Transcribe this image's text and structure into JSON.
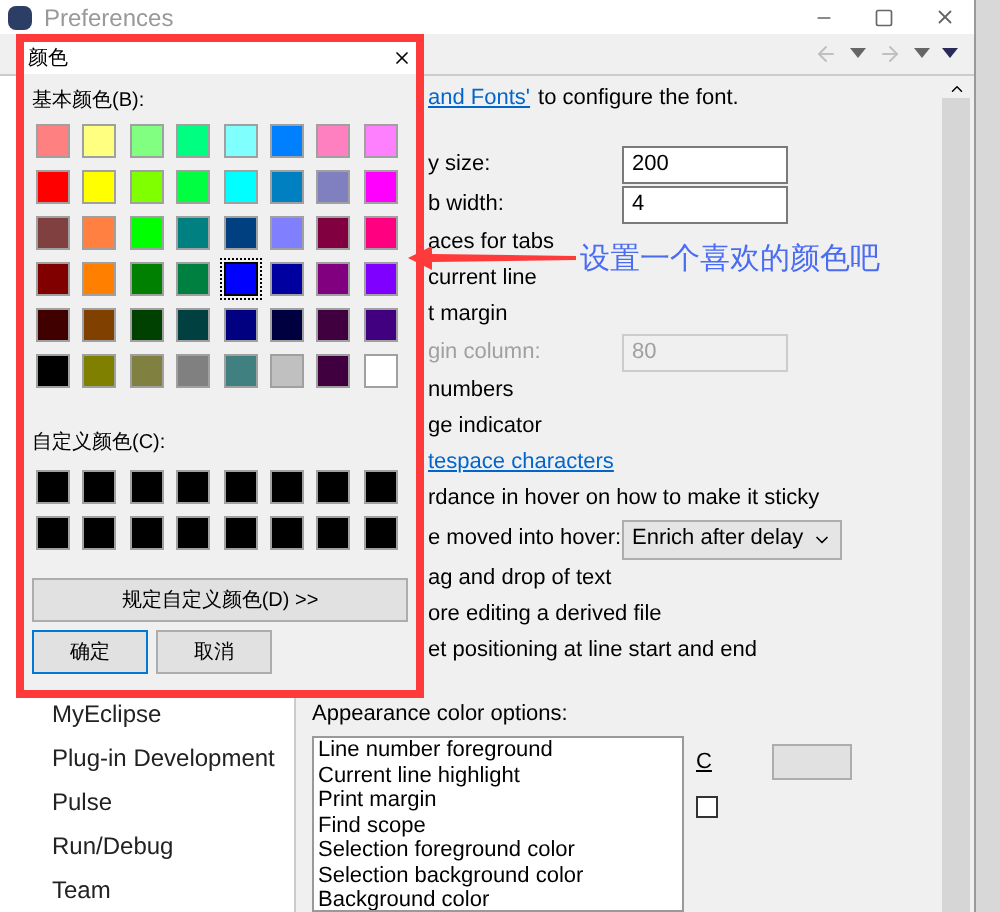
{
  "window": {
    "title": "Preferences"
  },
  "sidebar": {
    "items": [
      "MyEclipse",
      "Plug-in Development",
      "Pulse",
      "Run/Debug",
      "Team"
    ]
  },
  "editor_panel": {
    "link_line": {
      "link": "and Fonts'",
      "text": "to configure the font."
    },
    "rows": [
      {
        "kind": "field",
        "label": "y size:",
        "value": "200",
        "disabled": false
      },
      {
        "kind": "field",
        "label": "b width:",
        "value": "4",
        "disabled": false
      },
      {
        "kind": "text",
        "label": "aces for tabs"
      },
      {
        "kind": "text",
        "label": "current line"
      },
      {
        "kind": "text",
        "label": "t margin"
      },
      {
        "kind": "field",
        "label": "gin column:",
        "value": "80",
        "disabled": true
      },
      {
        "kind": "text",
        "label": "numbers"
      },
      {
        "kind": "text",
        "label": "ge indicator"
      },
      {
        "kind": "link",
        "label": "tespace characters"
      },
      {
        "kind": "text",
        "label": "rdance in hover on how to make it sticky"
      },
      {
        "kind": "select",
        "label": "e moved into hover:",
        "value": "Enrich after delay"
      },
      {
        "kind": "text",
        "label": "ag and drop of text"
      },
      {
        "kind": "text",
        "label": "ore editing a derived file"
      },
      {
        "kind": "text",
        "label": "et positioning at line start and end"
      }
    ],
    "appearance": {
      "label": "Appearance color options:",
      "items": [
        "Line number foreground",
        "Current line highlight",
        "Print margin",
        "Find scope",
        "Selection foreground color",
        "Selection background color",
        "Background color"
      ],
      "color_label": "C",
      "checkbox_checked": false
    }
  },
  "color_dialog": {
    "title": "颜色",
    "basic_label": "基本颜色(B):",
    "basic_colors": [
      {
        "color": "#ff8080",
        "selected": false
      },
      {
        "color": "#ffff80",
        "selected": false
      },
      {
        "color": "#80ff80",
        "selected": false
      },
      {
        "color": "#00ff80",
        "selected": false
      },
      {
        "color": "#80ffff",
        "selected": false
      },
      {
        "color": "#0080ff",
        "selected": false
      },
      {
        "color": "#ff80c0",
        "selected": false
      },
      {
        "color": "#ff80ff",
        "selected": false
      },
      {
        "color": "#ff0000",
        "selected": false
      },
      {
        "color": "#ffff00",
        "selected": false
      },
      {
        "color": "#80ff00",
        "selected": false
      },
      {
        "color": "#00ff40",
        "selected": false
      },
      {
        "color": "#00ffff",
        "selected": false
      },
      {
        "color": "#0080c0",
        "selected": false
      },
      {
        "color": "#8080c0",
        "selected": false
      },
      {
        "color": "#ff00ff",
        "selected": false
      },
      {
        "color": "#804040",
        "selected": false
      },
      {
        "color": "#ff8040",
        "selected": false
      },
      {
        "color": "#00ff00",
        "selected": false
      },
      {
        "color": "#008080",
        "selected": false
      },
      {
        "color": "#004080",
        "selected": false
      },
      {
        "color": "#8080ff",
        "selected": false
      },
      {
        "color": "#800040",
        "selected": false
      },
      {
        "color": "#ff0080",
        "selected": false
      },
      {
        "color": "#800000",
        "selected": false
      },
      {
        "color": "#ff8000",
        "selected": false
      },
      {
        "color": "#008000",
        "selected": false
      },
      {
        "color": "#008040",
        "selected": false
      },
      {
        "color": "#0000ff",
        "selected": true
      },
      {
        "color": "#0000a0",
        "selected": false
      },
      {
        "color": "#800080",
        "selected": false
      },
      {
        "color": "#8000ff",
        "selected": false
      },
      {
        "color": "#400000",
        "selected": false
      },
      {
        "color": "#804000",
        "selected": false
      },
      {
        "color": "#004000",
        "selected": false
      },
      {
        "color": "#004040",
        "selected": false
      },
      {
        "color": "#000080",
        "selected": false
      },
      {
        "color": "#000040",
        "selected": false
      },
      {
        "color": "#400040",
        "selected": false
      },
      {
        "color": "#400080",
        "selected": false
      },
      {
        "color": "#000000",
        "selected": false
      },
      {
        "color": "#808000",
        "selected": false
      },
      {
        "color": "#808040",
        "selected": false
      },
      {
        "color": "#808080",
        "selected": false
      },
      {
        "color": "#408080",
        "selected": false
      },
      {
        "color": "#c0c0c0",
        "selected": false
      },
      {
        "color": "#400040",
        "selected": false
      },
      {
        "color": "#ffffff",
        "selected": false
      }
    ],
    "custom_label": "自定义颜色(C):",
    "custom_colors": [
      {
        "color": "#000000"
      },
      {
        "color": "#000000"
      },
      {
        "color": "#000000"
      },
      {
        "color": "#000000"
      },
      {
        "color": "#000000"
      },
      {
        "color": "#000000"
      },
      {
        "color": "#000000"
      },
      {
        "color": "#000000"
      },
      {
        "color": "#000000"
      },
      {
        "color": "#000000"
      },
      {
        "color": "#000000"
      },
      {
        "color": "#000000"
      },
      {
        "color": "#000000"
      },
      {
        "color": "#000000"
      },
      {
        "color": "#000000"
      },
      {
        "color": "#000000"
      }
    ],
    "define_button": "规定自定义颜色(D) >>",
    "ok_button": "确定",
    "cancel_button": "取消"
  },
  "annotation": {
    "text": "设置一个喜欢的颜色吧"
  }
}
